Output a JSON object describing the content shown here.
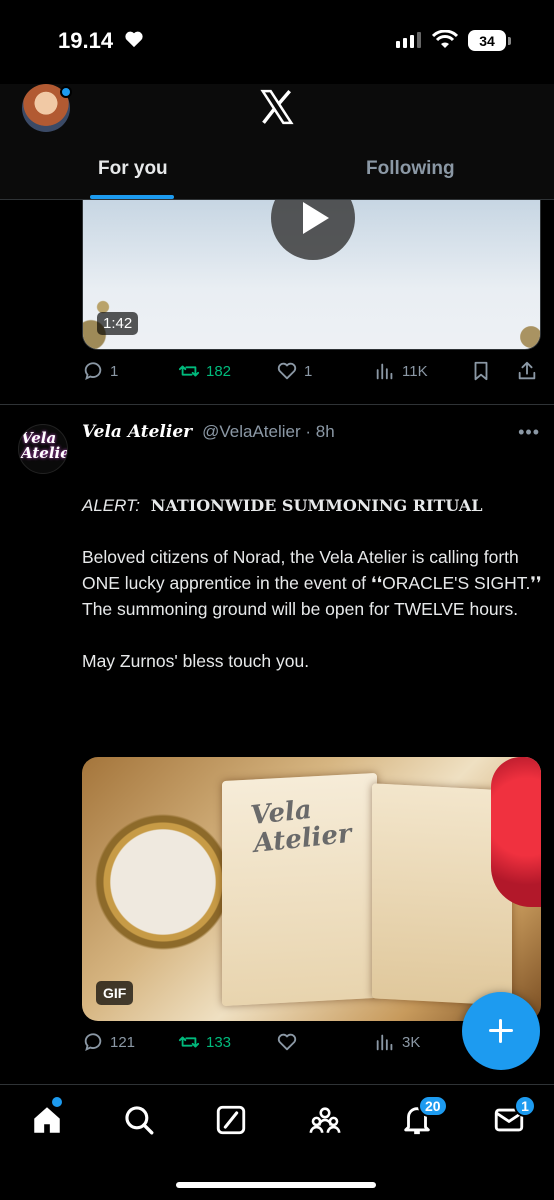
{
  "status_bar": {
    "time": "19.14",
    "battery": "34"
  },
  "header": {
    "tabs": [
      {
        "label": "For you",
        "active": true
      },
      {
        "label": "Following",
        "active": false
      }
    ]
  },
  "prev_post": {
    "video_duration": "1:42",
    "replies": "1",
    "reposts": "182",
    "likes": "1",
    "views": "11K"
  },
  "post": {
    "avatar_text": "Vela Atelier",
    "display_name": "Vela Atelier",
    "handle": "@VelaAtelier",
    "time": "8h",
    "alert_label": "ALERT:",
    "alert_title": "NATIONWIDE SUMMONING RITUAL",
    "paragraph1": "Beloved citizens of Norad, the Vela Atelier is calling forth ONE lucky apprentice in the event of ❛❛ORACLE'S SIGHT.❜❜ The summoning ground will be open for TWELVE hours.",
    "paragraph2": "May Zurnos' bless touch you.",
    "media_badge": "GIF",
    "media_title_line1": "Vela",
    "media_title_line2": "Atelier",
    "replies": "121",
    "reposts": "133",
    "views": "3K"
  },
  "bottom_nav": {
    "notifications_count": "20",
    "messages_count": "1"
  },
  "colors": {
    "accent": "#1d9bf0",
    "repost_green": "#00ba7c",
    "muted": "#8b98a5"
  }
}
